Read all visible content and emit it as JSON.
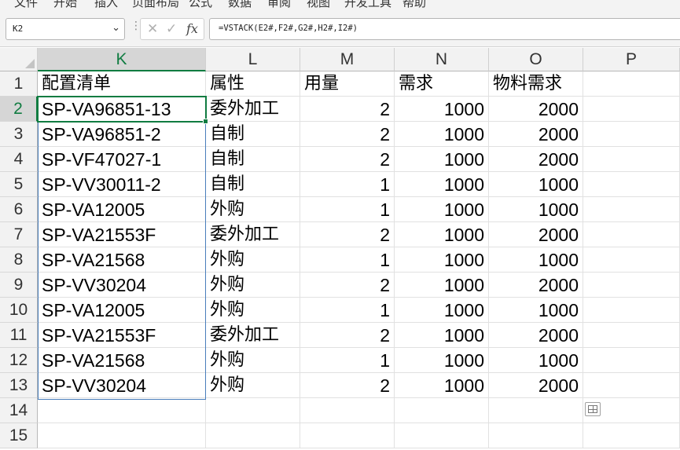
{
  "ribbon": {
    "tabs": [
      "文件",
      "开始",
      "插入",
      "页面布局",
      "公式",
      "数据",
      "审阅",
      "视图",
      "开发工具",
      "帮助"
    ]
  },
  "formula_bar": {
    "name_box": "K2",
    "formula": "=VSTACK(E2#,F2#,G2#,H2#,I2#)",
    "icons": {
      "cancel": "close-icon",
      "enter": "check-icon",
      "function": "fx-icon"
    }
  },
  "sheet": {
    "columns": [
      "K",
      "L",
      "M",
      "N",
      "O",
      "P"
    ],
    "active_column": "K",
    "rows": [
      "1",
      "2",
      "3",
      "4",
      "5",
      "6",
      "7",
      "8",
      "9",
      "10",
      "11",
      "12",
      "13",
      "14",
      "15"
    ],
    "active_row": "2",
    "header_row": [
      "配置清单",
      "属性",
      "用量",
      "需求",
      "物料需求"
    ],
    "data_rows": [
      [
        "SP-VA96851-13",
        "委外加工",
        "2",
        "1000",
        "2000"
      ],
      [
        "SP-VA96851-2",
        "自制",
        "2",
        "1000",
        "2000"
      ],
      [
        "SP-VF47027-1",
        "自制",
        "2",
        "1000",
        "2000"
      ],
      [
        "SP-VV30011-2",
        "自制",
        "1",
        "1000",
        "1000"
      ],
      [
        "SP-VA12005",
        "外购",
        "1",
        "1000",
        "1000"
      ],
      [
        "SP-VA21553F",
        "委外加工",
        "2",
        "1000",
        "2000"
      ],
      [
        "SP-VA21568",
        "外购",
        "1",
        "1000",
        "1000"
      ],
      [
        "SP-VV30204",
        "外购",
        "2",
        "1000",
        "2000"
      ],
      [
        "SP-VA12005",
        "外购",
        "1",
        "1000",
        "1000"
      ],
      [
        "SP-VA21553F",
        "委外加工",
        "2",
        "1000",
        "2000"
      ],
      [
        "SP-VA21568",
        "外购",
        "1",
        "1000",
        "1000"
      ],
      [
        "SP-VV30204",
        "外购",
        "2",
        "1000",
        "2000"
      ]
    ],
    "accent_color": "#107c41",
    "spill_border_color": "#4a7ebb"
  },
  "quick_analysis_icon": "quick-analysis-icon"
}
